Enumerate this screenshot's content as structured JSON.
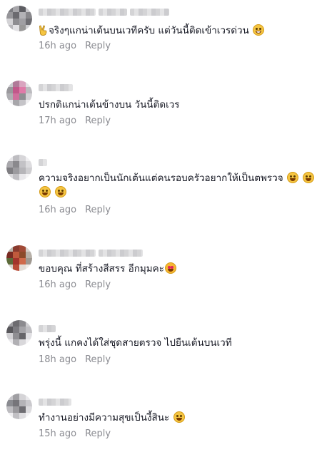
{
  "comments": [
    {
      "text": "จริงๆแกน่าเต้นบนเวทีครับ แต่วันนี้ติดเข้าเวรด่วน",
      "time": "16h ago",
      "reply": "Reply",
      "lead_icon": "victory-hand-icon",
      "trail_icon": "grinning-face-icon"
    },
    {
      "text": "ปรกติแกน่าเต้นข้างบน วันนี้ติดเวร",
      "time": "17h ago",
      "reply": "Reply"
    },
    {
      "text": "ความจริงอยากเป็นนักเต้นแต่คนรอบครัวอยากให้เป็นตพรวจ",
      "time": "16h ago",
      "reply": "Reply",
      "trail_icon": "rolling-laughing-face-icon"
    },
    {
      "text": "ขอบคุณ ที่สร้างสีสรร อีกมุมคะ",
      "time": "16h ago",
      "reply": "Reply",
      "trail_icon": "smiling-face-hearts-icon"
    },
    {
      "text": "พรุ่งนี้ แกคงได้ใส่ชุดสายตรวจ ไปยืนเต้นบนเวที",
      "time": "18h ago",
      "reply": "Reply"
    },
    {
      "text": "ทำงานอย่างมีความสุขเป็นงี้สินะ",
      "time": "15h ago",
      "reply": "Reply",
      "trail_icon": "rolling-laughing-face-icon"
    }
  ]
}
